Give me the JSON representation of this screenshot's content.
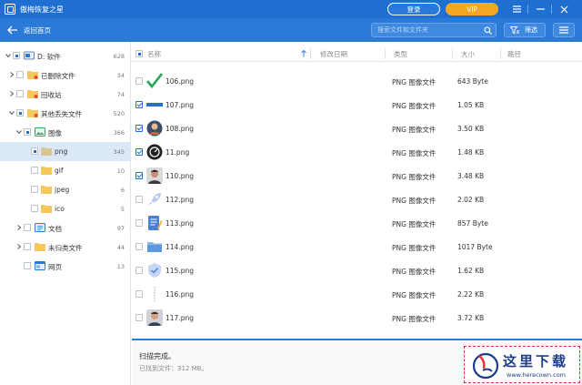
{
  "app": {
    "title": "傲梅恢复之星"
  },
  "titlebar": {
    "login_label": "登录",
    "vip_label": "VIP"
  },
  "toolbar": {
    "back_label": "返回首页",
    "search_placeholder": "搜索文件和文件夹",
    "filter_label": "筛选"
  },
  "sidebar": {
    "items": [
      {
        "label": "D: 软件",
        "count": "628"
      },
      {
        "label": "已删除文件",
        "count": "34"
      },
      {
        "label": "回收站",
        "count": "74"
      },
      {
        "label": "其他丢失文件",
        "count": "520"
      },
      {
        "label": "图像",
        "count": "366"
      },
      {
        "label": "png",
        "count": "345"
      },
      {
        "label": "gif",
        "count": "10"
      },
      {
        "label": "jpeg",
        "count": "6"
      },
      {
        "label": "ico",
        "count": "5"
      },
      {
        "label": "文档",
        "count": "97"
      },
      {
        "label": "未归类文件",
        "count": "44"
      },
      {
        "label": "网页",
        "count": "13"
      }
    ]
  },
  "table": {
    "columns": {
      "name": "名称",
      "date": "修改日期",
      "type": "类型",
      "size": "大小",
      "path": "路径"
    },
    "rows": [
      {
        "name": "106.png",
        "type": "PNG 图像文件",
        "size": "643 Byte",
        "checked": false
      },
      {
        "name": "107.png",
        "type": "PNG 图像文件",
        "size": "1.05 KB",
        "checked": true
      },
      {
        "name": "108.png",
        "type": "PNG 图像文件",
        "size": "3.50 KB",
        "checked": true
      },
      {
        "name": "11.png",
        "type": "PNG 图像文件",
        "size": "1.48 KB",
        "checked": true
      },
      {
        "name": "110.png",
        "type": "PNG 图像文件",
        "size": "3.48 KB",
        "checked": true
      },
      {
        "name": "112.png",
        "type": "PNG 图像文件",
        "size": "2.02 KB",
        "checked": false
      },
      {
        "name": "113.png",
        "type": "PNG 图像文件",
        "size": "857 Byte",
        "checked": false
      },
      {
        "name": "114.png",
        "type": "PNG 图像文件",
        "size": "1017 Byte",
        "checked": false
      },
      {
        "name": "115.png",
        "type": "PNG 图像文件",
        "size": "1.62 KB",
        "checked": false
      },
      {
        "name": "116.png",
        "type": "PNG 图像文件",
        "size": "2.22 KB",
        "checked": false
      },
      {
        "name": "117.png",
        "type": "PNG 图像文件",
        "size": "3.72 KB",
        "checked": false
      }
    ]
  },
  "status": {
    "main": "扫描完成。",
    "sub": "已找到文件：312 MB。"
  },
  "watermark": {
    "title": "这里下载",
    "url": "www.herecown.com"
  },
  "colors": {
    "brand": "#1f6fd1",
    "toolbar": "#2a7ad8",
    "vip": "#f5a623",
    "selected_row": "#dbe8f8"
  }
}
